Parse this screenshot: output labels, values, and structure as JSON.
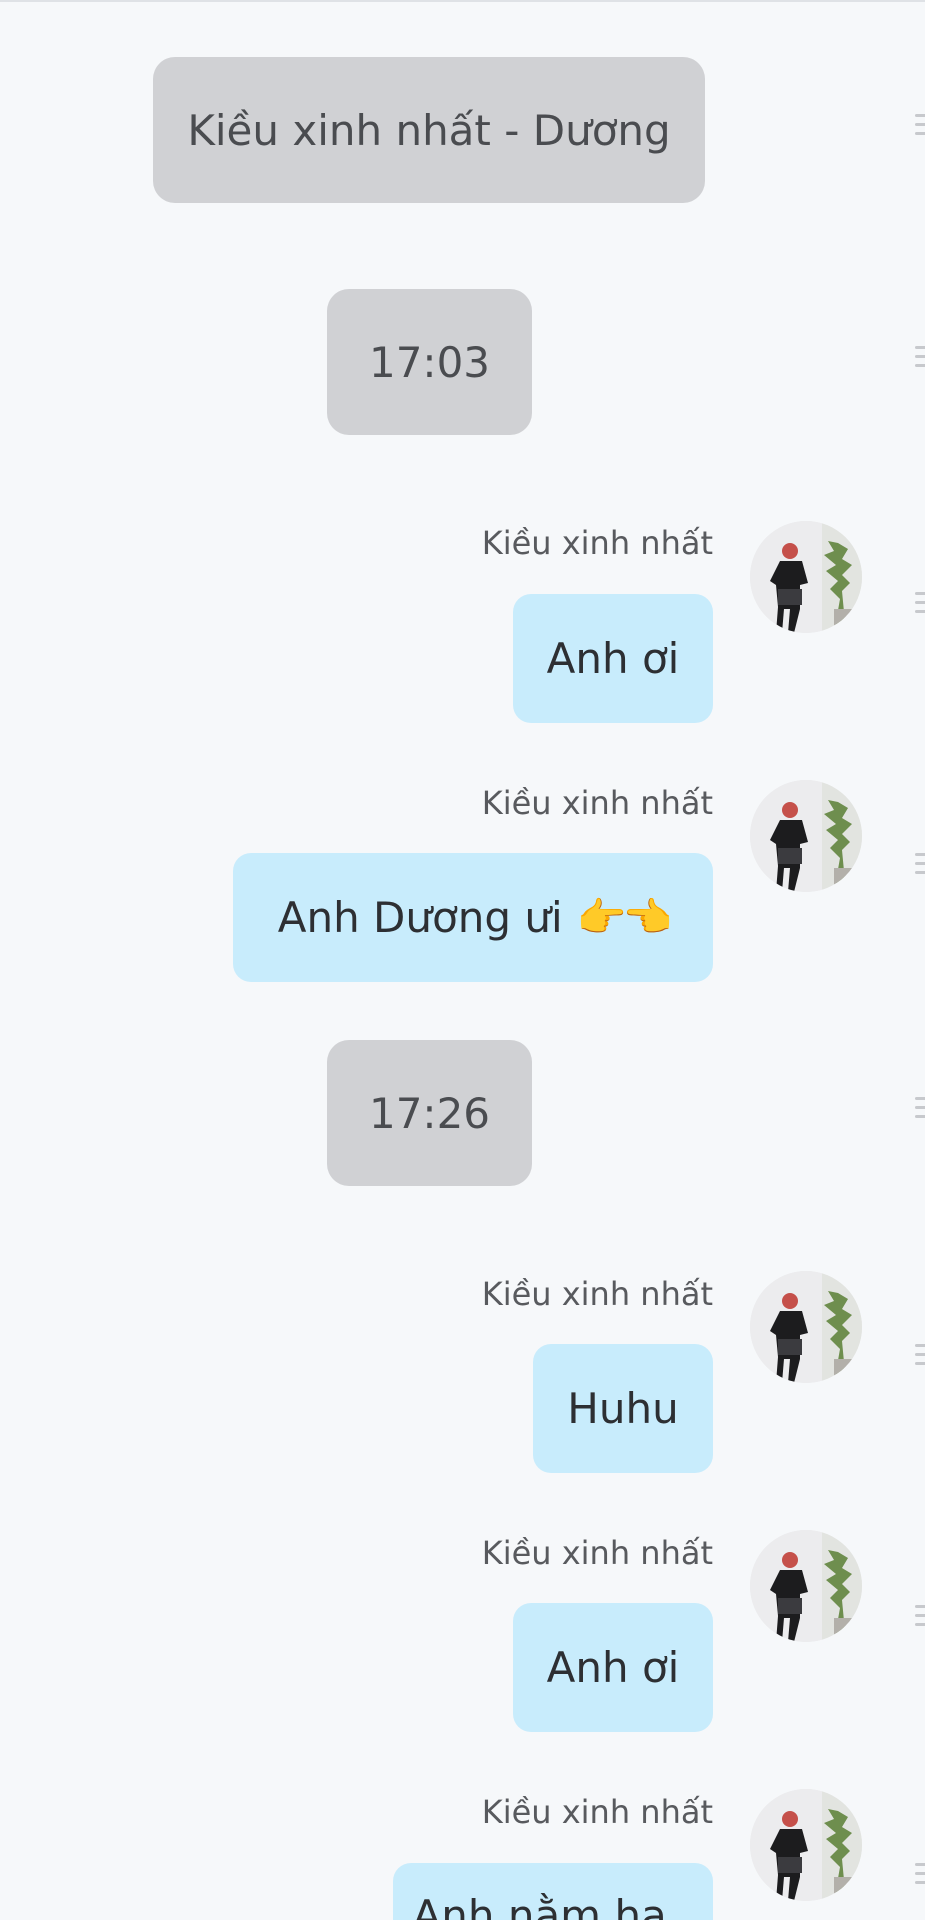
{
  "conversation": {
    "title_pill": "Kiều xinh nhất - Dương",
    "time_1": "17:03",
    "time_2": "17:26"
  },
  "messages": [
    {
      "sender": "Kiều xinh nhất",
      "text": "Anh ơi"
    },
    {
      "sender": "Kiều xinh nhất",
      "text": "Anh Dương ưi",
      "emoji": "👉👈"
    },
    {
      "sender": "Kiều xinh nhất",
      "text": "Huhu"
    },
    {
      "sender": "Kiều xinh nhất",
      "text": "Anh ơi"
    },
    {
      "sender": "Kiều xinh nhất",
      "text": "Anh nằm ha.."
    }
  ],
  "icons": {
    "avatar": "avatar-photo",
    "handle": "drag-handle-icon"
  },
  "colors": {
    "background": "#f6f8fa",
    "system_pill": "#d0d1d4",
    "bubble": "#c8ecfc"
  }
}
